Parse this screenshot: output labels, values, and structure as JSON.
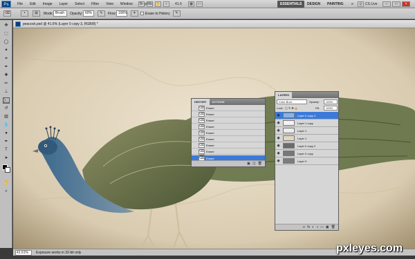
{
  "app": {
    "logo": "Ps"
  },
  "menubar": {
    "menus": [
      "File",
      "Edit",
      "Image",
      "Layer",
      "Select",
      "Filter",
      "View",
      "Window",
      "Help"
    ],
    "zoom": "41.6",
    "workspaces": [
      "ESSENTIALS",
      "DESIGN",
      "PAINTING"
    ],
    "search_icon": "chevron-double-right-icon",
    "cslive": "CS Live",
    "window_buttons": [
      "–",
      "□",
      "×"
    ]
  },
  "options": {
    "mode_label": "Mode:",
    "mode_value": "Brush",
    "opacity_label": "Opacity:",
    "opacity_value": "60%",
    "flow_label": "Flow:",
    "flow_value": "100%",
    "erase_history_label": "Erase to History"
  },
  "document": {
    "tab_title": "peacock.psd @ 41.6% (Layer 0 copy 3, RGB/8) *",
    "zoom": "41.61%",
    "status": "Exposure works in 32-bit only"
  },
  "history_panel": {
    "tabs": [
      "HISTORY",
      "ACTIONS"
    ],
    "items": [
      "Eraser",
      "Eraser",
      "Eraser",
      "Eraser",
      "Eraser",
      "Eraser",
      "Eraser",
      "Eraser",
      "Eraser",
      "Eraser"
    ],
    "selected_index": 9
  },
  "layers_panel": {
    "tabs": [
      "LAYERS"
    ],
    "blend_mode": "Color Burn",
    "opacity_label": "Opacity:",
    "opacity_value": "100%",
    "lock_label": "Lock:",
    "fill_label": "Fill:",
    "fill_value": "100%",
    "footer_label": "fx",
    "layers": [
      "Layer 0 copy 3",
      "Layer 1 copy",
      "Layer 1",
      "Layer 1",
      "Layer 0 copy 2",
      "Layer 0 copy",
      "Layer 0"
    ],
    "selected_index": 0
  },
  "watermark": "pxleyes.com",
  "colors": {
    "accent": "#3b7ad9",
    "selection": "#3b7ad9"
  }
}
